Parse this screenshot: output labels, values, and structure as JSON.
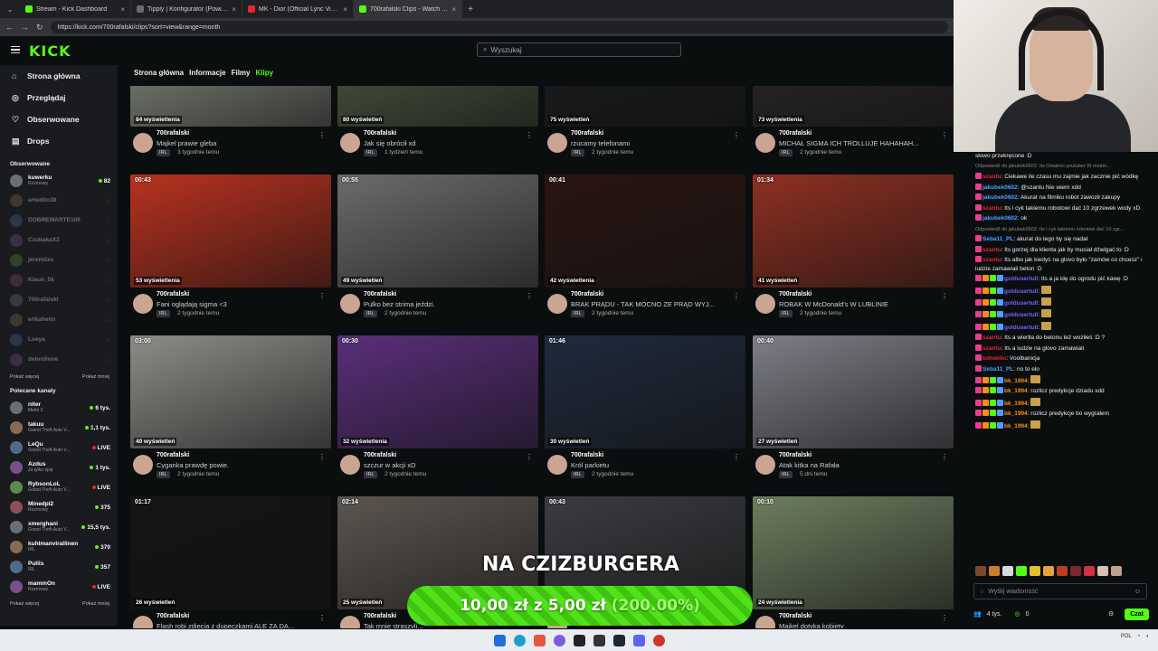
{
  "browser": {
    "tabs": [
      {
        "label": "Stream - Kick Dashboard",
        "color": "#53fc18",
        "active": false
      },
      {
        "label": "Tipply | Konfigurator (Powiadom...",
        "color": "#6b6b6b",
        "active": false
      },
      {
        "label": "MK - Dior (Official Lyric Video) ft.",
        "color": "#e4282c",
        "active": false
      },
      {
        "label": "700rafalski Clips - Watch Liv...",
        "color": "#53fc18",
        "active": true
      }
    ],
    "url": "https://kick.com/700rafalski/clips?sort=view&range=month"
  },
  "header": {
    "logo": "KICK",
    "search_placeholder": "Wyszukaj"
  },
  "sidebar": {
    "nav": [
      {
        "label": "Strona główna",
        "icon": "home-icon"
      },
      {
        "label": "Przeglądaj",
        "icon": "compass-icon"
      },
      {
        "label": "Obserwowane",
        "icon": "heart-icon"
      },
      {
        "label": "Drops",
        "icon": "drops-icon"
      }
    ],
    "followed_title": "Obserwowane",
    "followed": [
      {
        "name": "kuwerku",
        "sub": "Rozmowy",
        "viewers": "82",
        "live": true
      },
      {
        "name": "artudito38",
        "sub": "",
        "viewers": "",
        "live": false
      },
      {
        "name": "DOBREWARTE100",
        "sub": "",
        "viewers": "",
        "live": false
      },
      {
        "name": "CzubakaXZ",
        "sub": "",
        "viewers": "",
        "live": false
      },
      {
        "name": "jeremiixs",
        "sub": "",
        "viewers": "",
        "live": false
      },
      {
        "name": "Klaun_0k",
        "sub": "",
        "viewers": "",
        "live": false
      },
      {
        "name": "700rafalski",
        "sub": "",
        "viewers": "",
        "live": false
      },
      {
        "name": "erikahelin",
        "sub": "",
        "viewers": "",
        "live": false
      },
      {
        "name": "Loeya",
        "sub": "",
        "viewers": "",
        "live": false
      },
      {
        "name": "delordione",
        "sub": "",
        "viewers": "",
        "live": false
      }
    ],
    "show_more": "Pokaż więcej",
    "show_less": "Pokaż mniej",
    "recommended_title": "Polecane kanały",
    "recommended": [
      {
        "name": "niter",
        "sub": "Metin 2",
        "viewers": "6 tys."
      },
      {
        "name": "takuu",
        "sub": "Grand Theft Auto V...",
        "viewers": "1,1 tys."
      },
      {
        "name": "LeQu",
        "sub": "Grand Theft Auto V...",
        "viewers": "LIVE"
      },
      {
        "name": "Azdus",
        "sub": "Ja tylko śpię",
        "viewers": "1 tys."
      },
      {
        "name": "RybsonLoL",
        "sub": "Grand Theft Auto V...",
        "viewers": "LIVE"
      },
      {
        "name": "Minedpl2",
        "sub": "Rozmowy",
        "viewers": "375"
      },
      {
        "name": "xmerghani",
        "sub": "Grand Theft Auto V...",
        "viewers": "15,5 tys."
      },
      {
        "name": "kuhlmanvirallinen",
        "sub": "IRL",
        "viewers": "370"
      },
      {
        "name": "Pullis",
        "sub": "IRL",
        "viewers": "357"
      },
      {
        "name": "mammOn",
        "sub": "Rozmowy",
        "viewers": "LIVE"
      }
    ]
  },
  "channel_nav": {
    "items": [
      "Strona główna",
      "Informacje",
      "Filmy",
      "Klipy"
    ],
    "active": "Klipy"
  },
  "clips": [
    {
      "duration": "",
      "views": "84 wyświetlenia",
      "channel": "700rafalski",
      "title": "Majkel prawie gleba",
      "category": "IRL",
      "ago": "3 tygodnie temu",
      "thumb": "#8d9087"
    },
    {
      "duration": "",
      "views": "80 wyświetleń",
      "channel": "700rafalski",
      "title": "Jak się obrócił xd",
      "category": "IRL",
      "ago": "1 tydzień temu",
      "thumb": "#4f5d45"
    },
    {
      "duration": "",
      "views": "75 wyświetleń",
      "channel": "700rafalski",
      "title": "rzucamy telefonami",
      "category": "IRL",
      "ago": "2 tygodnie temu",
      "thumb": "#1b1c20"
    },
    {
      "duration": "",
      "views": "73 wyświetlenia",
      "channel": "700rafalski",
      "title": "MICHAŁ SIGMA ICH TROLLUJE HAHAHAH...",
      "category": "IRL",
      "ago": "2 tygodnie temu",
      "thumb": "#2c2a27"
    },
    {
      "duration": "00:43",
      "views": "53 wyświetlenia",
      "channel": "700rafalski",
      "title": "Fani oglądają sigma <3",
      "category": "IRL",
      "ago": "2 tygodnie temu",
      "thumb": "#b8321f"
    },
    {
      "duration": "00:55",
      "views": "49 wyświetleń",
      "channel": "700rafalski",
      "title": "Pulko bez strima jeździ.",
      "category": "IRL",
      "ago": "2 tygodnie temu",
      "thumb": "#6b6c6a"
    },
    {
      "duration": "00:41",
      "views": "42 wyświetlenia",
      "channel": "700rafalski",
      "title": "BRAK PRĄDU - TAK MOCNO ZE PRĄD WYJ...",
      "category": "IRL",
      "ago": "2 tygodnie temu",
      "thumb": "#2a1512"
    },
    {
      "duration": "01:34",
      "views": "41 wyświetleń",
      "channel": "700rafalski",
      "title": "ROBAK W McDonald's W LUBLINIE",
      "category": "IRL",
      "ago": "2 tygodnie temu",
      "thumb": "#8e3022"
    },
    {
      "duration": "03:00",
      "views": "40 wyświetleń",
      "channel": "700rafalski",
      "title": "Cyganka prawdę powie.",
      "category": "IRL",
      "ago": "2 tygodnie temu",
      "thumb": "#8d8c88"
    },
    {
      "duration": "00:30",
      "views": "32 wyświetlenia",
      "channel": "700rafalski",
      "title": "szczur w akcji xD",
      "category": "IRL",
      "ago": "2 tygodnie temu",
      "thumb": "#5a2f7a"
    },
    {
      "duration": "01:46",
      "views": "30 wyświetleń",
      "channel": "700rafalski",
      "title": "Król parkietu",
      "category": "IRL",
      "ago": "2 tygodnie temu",
      "thumb": "#1f2a3d"
    },
    {
      "duration": "00:40",
      "views": "27 wyświetleń",
      "channel": "700rafalski",
      "title": "Atak kitka na Rafała",
      "category": "IRL",
      "ago": "5 dni temu",
      "thumb": "#7d7e86"
    },
    {
      "duration": "01:17",
      "views": "26 wyświetleń",
      "channel": "700rafalski",
      "title": "Flash robi zdjęcia z dupeczkami ALE ZA DA...",
      "category": "IRL",
      "ago": "",
      "thumb": "#141414"
    },
    {
      "duration": "02:14",
      "views": "25 wyświetleń",
      "channel": "700rafalski",
      "title": "Tak mnie straszyli...",
      "category": "IRL",
      "ago": "",
      "thumb": "#5c5550"
    },
    {
      "duration": "00:43",
      "views": "",
      "channel": "700rafalski",
      "title": "",
      "category": "IRL",
      "ago": "",
      "thumb": "#3b3c40"
    },
    {
      "duration": "00:10",
      "views": "24 wyświetlenia",
      "channel": "700rafalski",
      "title": "Majkel dotyka kobiety",
      "category": "IRL",
      "ago": "",
      "thumb": "#6d7e5e"
    }
  ],
  "chat": {
    "pinned_text": "słowo przekręcone :D",
    "messages": [
      {
        "type": "reply",
        "text": "Odpowiedź do jakubek0602: Its Ostatnio youtuber W matrio..."
      },
      {
        "user": "szantu",
        "color": "#e4282c",
        "text": "Ciekawe ile czasu mu zajmie jak zacznie pić wódkę"
      },
      {
        "user": "jakubek0602",
        "color": "#4aa3ff",
        "text": "@szantu Nie wiem xdd"
      },
      {
        "user": "jakubek0602",
        "color": "#4aa3ff",
        "text": "Akurat na filmiku robot zawoził zakupy"
      },
      {
        "user": "szantu",
        "color": "#e4282c",
        "text": "Its i cyk takiemu robotowi dać 10 zgrzewek wody xD"
      },
      {
        "user": "jakubek0602",
        "color": "#4aa3ff",
        "text": "ok"
      },
      {
        "type": "reply",
        "text": "Odpowiedź do jakubek0602: Its i cyk takiemu robotowi dać 10 zgr..."
      },
      {
        "user": "Seba11_PL",
        "color": "#4aa3ff",
        "text": "akurat do tego by się nadał"
      },
      {
        "user": "szantu",
        "color": "#e4282c",
        "text": "Its gorzej dla klienta jak by musiał dźwigać to :D"
      },
      {
        "user": "szantu",
        "color": "#e4282c",
        "text": "Its albo jak kiedyś na glovo było \"zamów co chcesz\" i ludzie zamawiali beton :D"
      },
      {
        "user": "goldusertull",
        "color": "#7b61ff",
        "text": "Its a ja idę do ogrodu pić kawę :D"
      },
      {
        "user": "goldusertull",
        "color": "#7b61ff",
        "text": ""
      },
      {
        "user": "goldusertull",
        "color": "#7b61ff",
        "text": ""
      },
      {
        "user": "goldusertull",
        "color": "#7b61ff",
        "text": ""
      },
      {
        "user": "goldusertull",
        "color": "#7b61ff",
        "text": ""
      },
      {
        "user": "szantu",
        "color": "#e4282c",
        "text": "Its a wiertła do betonu też woziłeś :D ?"
      },
      {
        "user": "szantu",
        "color": "#e4282c",
        "text": "Its a ludzie na glovo zamawiali"
      },
      {
        "user": "tobwello",
        "color": "#e4282c",
        "text": "Voolbanicja"
      },
      {
        "user": "Seba11_PL",
        "color": "#4aa3ff",
        "text": "no to elo"
      },
      {
        "user": "bk_1994",
        "color": "#ff8c1a",
        "text": ""
      },
      {
        "user": "bk_1994",
        "color": "#ff8c1a",
        "text": "rozlicz predykcje dziadu xdd"
      },
      {
        "user": "bk_1994",
        "color": "#ff8c1a",
        "text": ""
      },
      {
        "user": "bk_1994",
        "color": "#ff8c1a",
        "text": "rozlicz predykcje bo wygrałem"
      },
      {
        "user": "bk_1994",
        "color": "#ff8c1a",
        "text": ""
      }
    ],
    "input_placeholder": "Wyślij wiadomość",
    "viewers": "4 tys.",
    "points": "0",
    "send_label": "Czat"
  },
  "overlay": {
    "headline": "NA CZIZBURGERA",
    "goal_current": "10,00 zł",
    "goal_sep": "z",
    "goal_target": "5,00 zł",
    "goal_pct": "(200.00%)"
  },
  "taskbar": {
    "tray": [
      "POL",
      "Wi-Fi",
      "sound"
    ]
  }
}
